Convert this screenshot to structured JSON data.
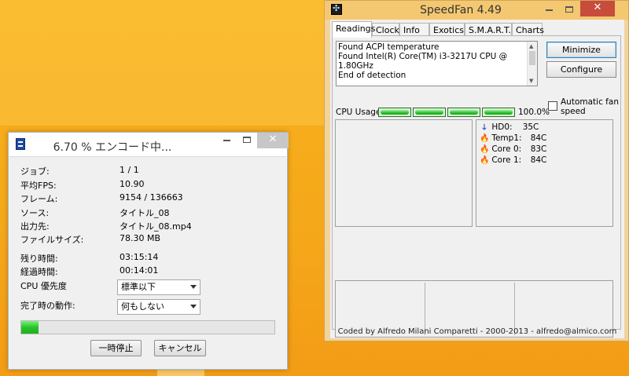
{
  "encoder": {
    "title": "6.70 % エンコード中...",
    "close_glyph": "✕",
    "rows": [
      {
        "label": "ジョブ:",
        "value": "1 / 1"
      },
      {
        "label": "平均FPS:",
        "value": "10.90"
      },
      {
        "label": "フレーム:",
        "value": "9154 / 136663"
      },
      {
        "label": "ソース:",
        "value": "タイトル_08"
      },
      {
        "label": "出力先:",
        "value": "タイトル_08.mp4"
      },
      {
        "label": "ファイルサイズ:",
        "value": "78.30 MB"
      },
      {
        "label": "残り時間:",
        "value": "03:15:14"
      },
      {
        "label": "経過時間:",
        "value": "00:14:01"
      }
    ],
    "cpu_priority": {
      "label": "CPU 優先度",
      "selected": "標準以下"
    },
    "on_complete": {
      "label": "完了時の動作:",
      "selected": "何もしない"
    },
    "progress_percent": 6.7,
    "buttons": {
      "pause": "一時停止",
      "cancel": "キャンセル"
    },
    "colors": {
      "progress": "#26c526"
    }
  },
  "speedfan": {
    "title": "SpeedFan 4.49",
    "close_glyph": "✕",
    "tabs": [
      "Readings",
      "Clock",
      "Info",
      "Exotics",
      "S.M.A.R.T.",
      "Charts"
    ],
    "active_tab": "Readings",
    "log_lines": [
      "Found ACPI temperature",
      "Found Intel(R) Core(TM) i3-3217U CPU @ 1.80GHz",
      "End of detection"
    ],
    "buttons": {
      "minimize": "Minimize",
      "configure": "Configure"
    },
    "auto_fan": {
      "label": "Automatic fan speed",
      "checked": false
    },
    "cpu_usage": {
      "label": "CPU Usage",
      "percent": "100.0%",
      "cores": [
        100,
        100,
        100,
        100
      ]
    },
    "temperatures": [
      {
        "icon": "arrow-down-icon",
        "name": "HD0:",
        "value": "35C"
      },
      {
        "icon": "flame-icon",
        "name": "Temp1:",
        "value": "84C"
      },
      {
        "icon": "flame-icon",
        "name": "Core 0:",
        "value": "83C"
      },
      {
        "icon": "flame-icon",
        "name": "Core 1:",
        "value": "84C"
      }
    ],
    "footer": "Coded by Alfredo Milani Comparetti - 2000-2013 - alfredo@almico.com",
    "colors": {
      "titlebar": "#f4c771",
      "close": "#c74c3c",
      "flame": "#e25311",
      "arrow": "#1b45b8"
    }
  }
}
